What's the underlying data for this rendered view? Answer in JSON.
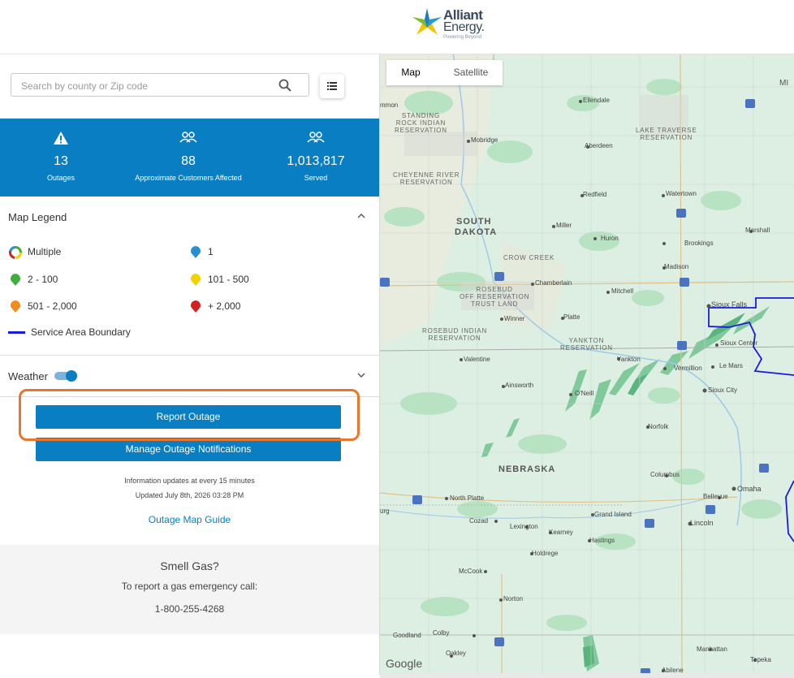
{
  "header": {
    "brand_line1": "Alliant",
    "brand_line2": "Energy.",
    "tagline": "Powering Beyond"
  },
  "search": {
    "placeholder": "Search by county or Zip code"
  },
  "stats": [
    {
      "icon": "warning-icon",
      "value": "13",
      "label": "Outages"
    },
    {
      "icon": "people-icon",
      "value": "88",
      "label": "Approximate Customers Affected"
    },
    {
      "icon": "people-icon",
      "value": "1,013,817",
      "label": "Served"
    }
  ],
  "legend": {
    "title": "Map Legend",
    "items": [
      {
        "label": "Multiple",
        "color": "multicolor"
      },
      {
        "label": "1",
        "color": "#2a8fd0"
      },
      {
        "label": "2 - 100",
        "color": "#3fae3f"
      },
      {
        "label": "101 - 500",
        "color": "#f2d200"
      },
      {
        "label": "501 - 2,000",
        "color": "#f08b1d"
      },
      {
        "label": "+ 2,000",
        "color": "#d32020"
      },
      {
        "label": "Service Area Boundary",
        "color": "#1a1adf"
      }
    ]
  },
  "weather": {
    "label": "Weather",
    "enabled": true
  },
  "buttons": {
    "report": "Report Outage",
    "manage": "Manage Outage Notifications"
  },
  "info": {
    "line1": "Information updates at every 15 minutes",
    "line2": "Updated July 8th, 2026 03:28 PM",
    "guide": "Outage Map Guide"
  },
  "gas": {
    "title": "Smell Gas?",
    "subtitle": "To report a gas emergency call:",
    "phone": "1-800-255-4268"
  },
  "map": {
    "tabs": [
      "Map",
      "Satellite"
    ],
    "active_tab": "Map",
    "attribution": "Google",
    "states": [
      "SOUTH",
      "DAKOTA",
      "NEBRASKA"
    ],
    "reservations": [
      [
        "STANDING",
        "ROCK INDIAN",
        "RESERVATION"
      ],
      [
        "CHEYENNE RIVER",
        "RESERVATION"
      ],
      [
        "LAKE TRAVERSE",
        "RESERVATION"
      ],
      [
        "CROW CREEK"
      ],
      [
        "ROSEBUD",
        "OFF RESERVATION",
        "TRUST LAND"
      ],
      [
        "ROSEBUD INDIAN",
        "RESERVATION"
      ],
      [
        "YANKTON",
        "RESERVATION"
      ]
    ],
    "cities": [
      "Ellendale",
      "Mobridge",
      "Aberdeen",
      "Redfield",
      "Watertown",
      "Miller",
      "Huron",
      "Brookings",
      "Marshall",
      "Madison",
      "Chamberlain",
      "Mitchell",
      "Sioux Falls",
      "Winner",
      "Platte",
      "Sioux Center",
      "Yankton",
      "Vermillion",
      "Le Mars",
      "Valentine",
      "Ainsworth",
      "O'Neill",
      "Sioux City",
      "Norfolk",
      "Columbus",
      "Omaha",
      "Bellevue",
      "North Platte",
      "Grand Island",
      "Lincoln",
      "Lexington",
      "Kearney",
      "Cozad",
      "Hastings",
      "Holdrege",
      "McCook",
      "Norton",
      "Goodland",
      "Colby",
      "Oakley",
      "Manhattan",
      "Abilene",
      "Topeka"
    ],
    "edge_labels": [
      "mmon",
      "urg",
      "MI"
    ]
  }
}
